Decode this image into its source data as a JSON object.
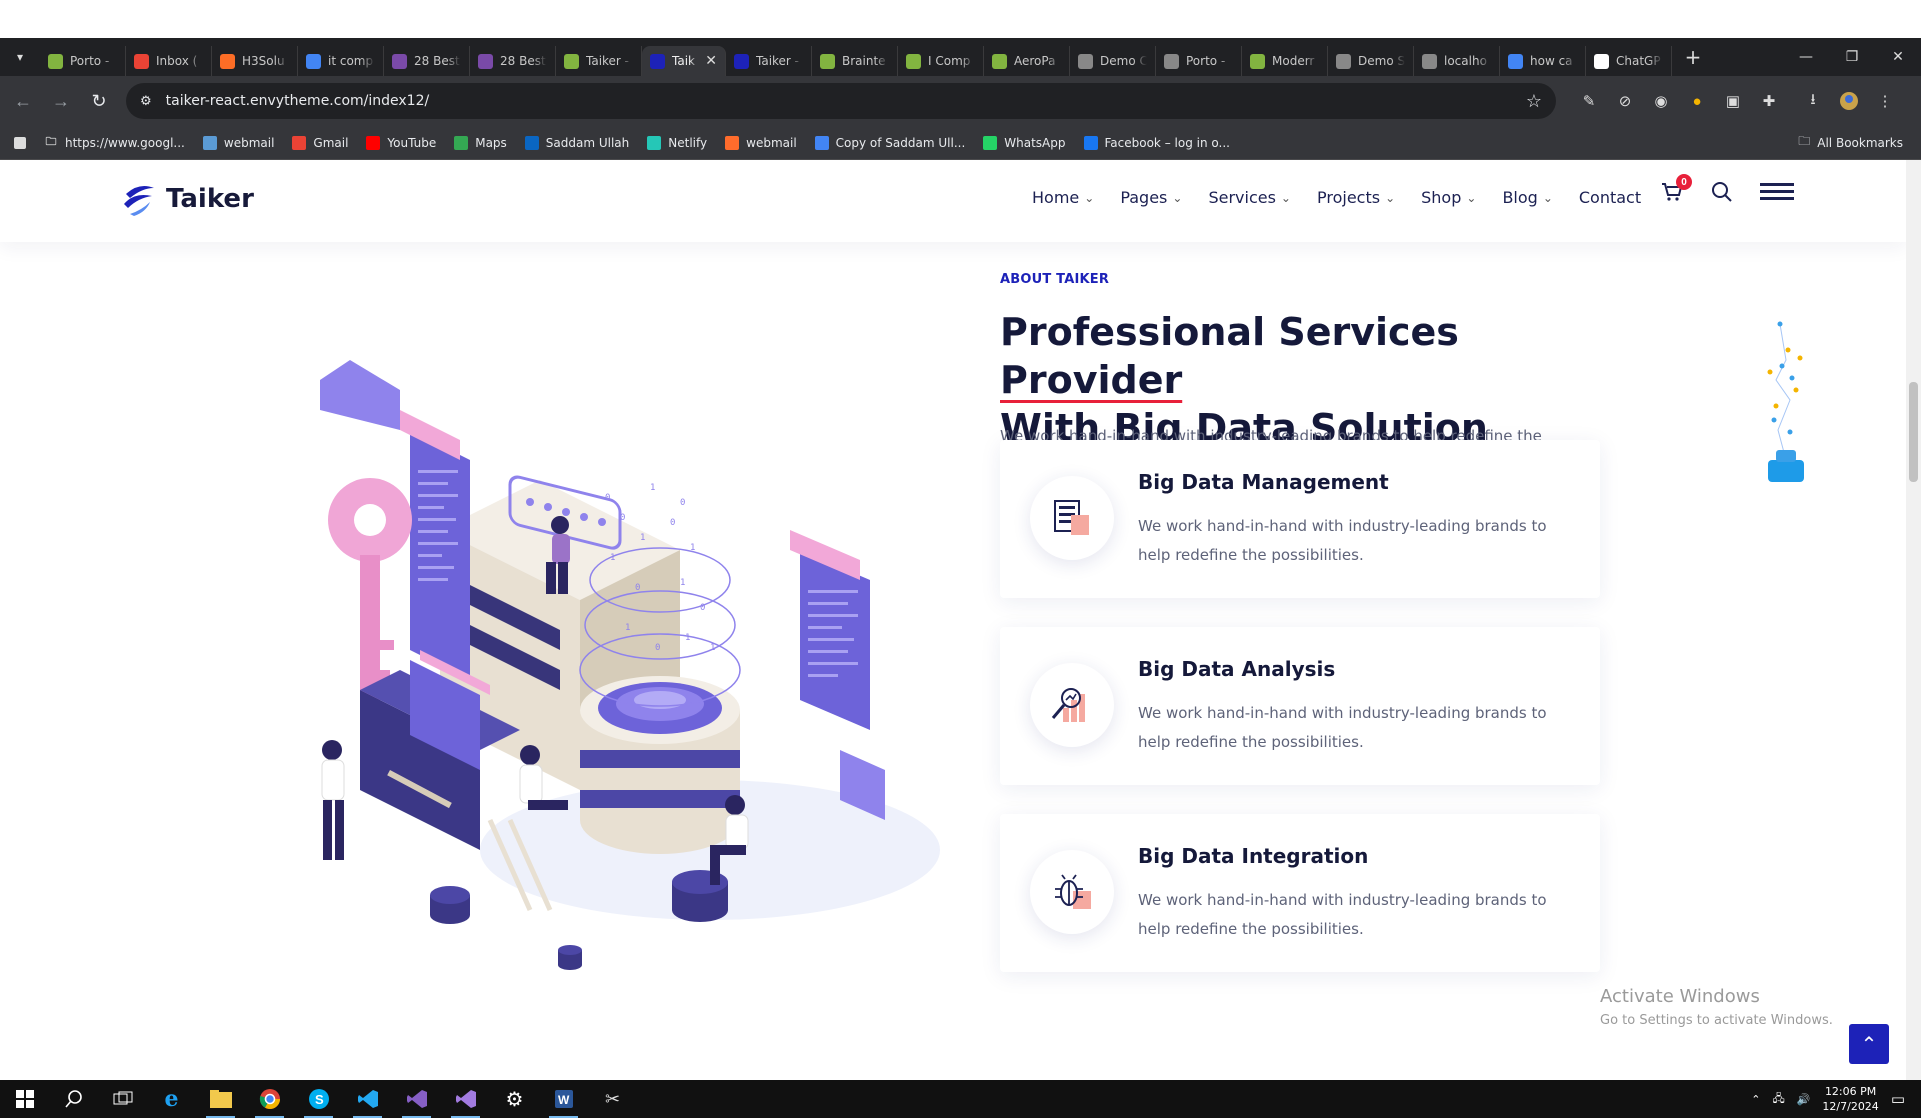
{
  "browser": {
    "tabs": [
      {
        "label": "Porto -",
        "icon": "envato-icon",
        "color": "#82b440"
      },
      {
        "label": "Inbox (",
        "icon": "gmail-icon",
        "color": "#ea4335"
      },
      {
        "label": "H3Solu",
        "icon": "gitlab-icon",
        "color": "#fc6d26"
      },
      {
        "label": "it comp",
        "icon": "google-icon",
        "color": "#4285f4"
      },
      {
        "label": "28 Best",
        "icon": "site-icon",
        "color": "#7a4aa8"
      },
      {
        "label": "28 Best",
        "icon": "site-icon",
        "color": "#7a4aa8"
      },
      {
        "label": "Taiker -",
        "icon": "envato-icon",
        "color": "#82b440"
      },
      {
        "label": "Taik",
        "icon": "taiker-icon",
        "color": "#1d22b8",
        "active": true
      },
      {
        "label": "Taiker -",
        "icon": "taiker-icon",
        "color": "#1d22b8"
      },
      {
        "label": "Brainte",
        "icon": "envato-icon",
        "color": "#82b440"
      },
      {
        "label": "I Comp",
        "icon": "envato-icon",
        "color": "#82b440"
      },
      {
        "label": "AeroPa",
        "icon": "envato-icon",
        "color": "#82b440"
      },
      {
        "label": "Demo C",
        "icon": "github-icon",
        "color": "#888888"
      },
      {
        "label": "Porto -",
        "icon": "github-icon",
        "color": "#888888"
      },
      {
        "label": "Moderr",
        "icon": "envato-icon",
        "color": "#82b440"
      },
      {
        "label": "Demo S",
        "icon": "github-icon",
        "color": "#888888"
      },
      {
        "label": "localho",
        "icon": "globe-icon",
        "color": "#888888"
      },
      {
        "label": "how ca",
        "icon": "google-icon",
        "color": "#4285f4"
      },
      {
        "label": "ChatGP",
        "icon": "chatgpt-icon",
        "color": "#ffffff"
      }
    ],
    "url": "taiker-react.envytheme.com/index12/",
    "bookmarks": [
      {
        "label": "https://www.googl...",
        "icon": "folder-icon"
      },
      {
        "label": "webmail",
        "icon": "webmail-icon"
      },
      {
        "label": "Gmail",
        "icon": "gmail-icon"
      },
      {
        "label": "YouTube",
        "icon": "youtube-icon"
      },
      {
        "label": "Maps",
        "icon": "maps-icon"
      },
      {
        "label": "Saddam Ullah",
        "icon": "linkedin-icon"
      },
      {
        "label": "Netlify",
        "icon": "netlify-icon"
      },
      {
        "label": "webmail",
        "icon": "cpanel-icon"
      },
      {
        "label": "Copy of Saddam Ull...",
        "icon": "google-icon"
      },
      {
        "label": "WhatsApp",
        "icon": "whatsapp-icon"
      },
      {
        "label": "Facebook – log in o...",
        "icon": "facebook-icon"
      }
    ],
    "all_bookmarks": "All Bookmarks"
  },
  "site": {
    "logo": "Taiker",
    "nav": [
      {
        "label": "Home",
        "dropdown": true
      },
      {
        "label": "Pages",
        "dropdown": true
      },
      {
        "label": "Services",
        "dropdown": true
      },
      {
        "label": "Projects",
        "dropdown": true
      },
      {
        "label": "Shop",
        "dropdown": true
      },
      {
        "label": "Blog",
        "dropdown": true
      },
      {
        "label": "Contact",
        "dropdown": false
      }
    ],
    "cart_count": "0",
    "eyebrow": "ABOUT TAIKER",
    "heading_part1": "Professional Services ",
    "heading_highlight": "Provider",
    "heading_part2": "With Big Data Solution",
    "lead": "We work hand-in-hand with industry-leading brands to help redefine the possibilities and potential of digital engagements We work hand-in-hand with industry-leading brands to help redefine the possibilities and potential.",
    "features": [
      {
        "title": "Big Data Management",
        "desc": "We work hand-in-hand with industry-leading brands to help redefine the possibilities.",
        "icon": "server-icon"
      },
      {
        "title": "Big Data Analysis",
        "desc": "We work hand-in-hand with industry-leading brands to help redefine the possibilities.",
        "icon": "analysis-icon"
      },
      {
        "title": "Big Data Integration",
        "desc": "We work hand-in-hand with industry-leading brands to help redefine the possibilities.",
        "icon": "bug-icon"
      }
    ],
    "accent_color": "#1d22b8",
    "highlight_color": "#e8203a"
  },
  "watermark": {
    "line1": "Activate Windows",
    "line2": "Go to Settings to activate Windows."
  },
  "taskbar": {
    "time": "12:06 PM",
    "date": "12/7/2024"
  }
}
